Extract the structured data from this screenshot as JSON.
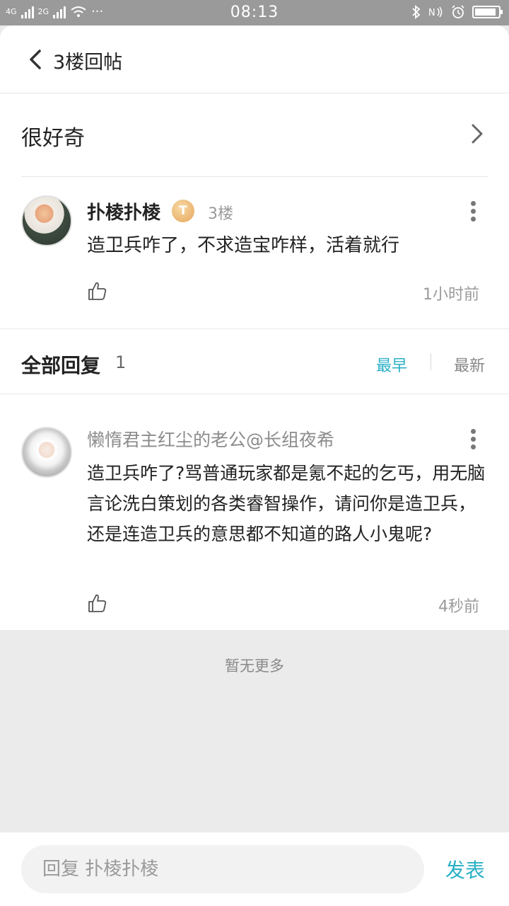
{
  "status_bar": {
    "net1": "4G",
    "net2": "2G",
    "dots": "···",
    "time": "08:13",
    "battery_level": 0.9
  },
  "header": {
    "title": "3楼回帖"
  },
  "thread": {
    "title": "很好奇"
  },
  "post": {
    "username": "扑棱扑棱",
    "badge": "T",
    "floor": "3楼",
    "text": "造卫兵咋了，不求造宝咋样，活着就行",
    "time": "1小时前"
  },
  "replies": {
    "title": "全部回复",
    "count": "1",
    "sort_earliest": "最早",
    "sort_latest": "最新",
    "active_sort_color": "#2ab0c6",
    "items": [
      {
        "username": "懒惰君主红尘的老公@长组夜希",
        "text": "造卫兵咋了?骂普通玩家都是氪不起的乞丐，用无脑言论洗白策划的各类睿智操作，请问你是造卫兵，还是连造卫兵的意思都不知道的路人小鬼呢?",
        "time": "4秒前"
      }
    ]
  },
  "footer": {
    "no_more": "暂无更多"
  },
  "bottom_bar": {
    "placeholder": "回复 扑棱扑棱",
    "send_label": "发表"
  }
}
